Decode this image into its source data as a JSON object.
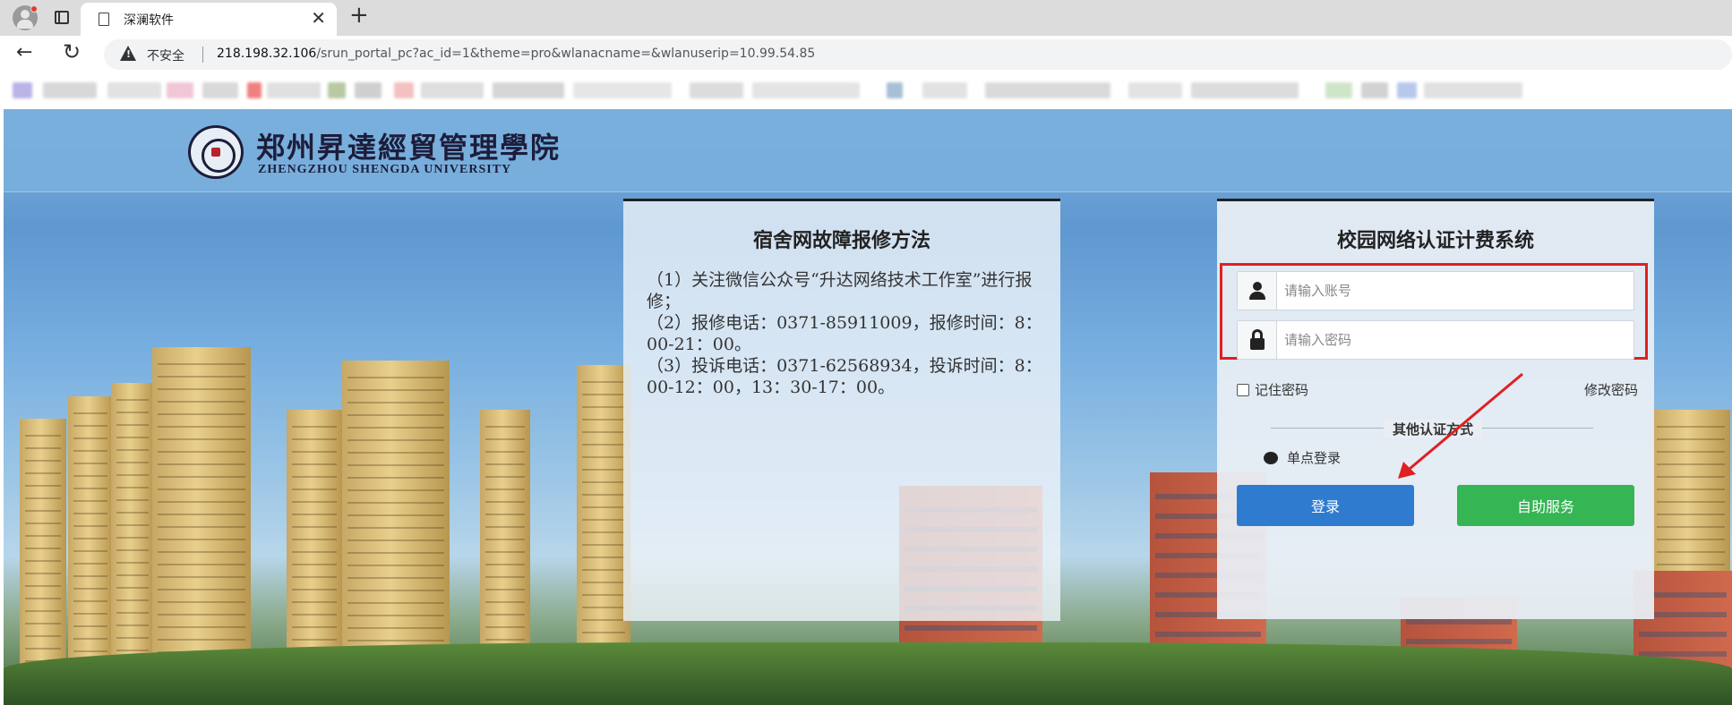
{
  "browser": {
    "tab_title": "深澜软件",
    "new_tab_symbol": "+",
    "close_symbol": "✕",
    "insecure_label": "不安全",
    "url_host": "218.198.32.106",
    "url_path": "/srun_portal_pc?ac_id=1&theme=pro&wlanacname=&wlanuserip=10.99.54.85"
  },
  "header": {
    "logo_cn": "郑州昇達經貿管理學院",
    "logo_en": "ZHENGZHOU SHENGDA UNIVERSITY"
  },
  "notice": {
    "title": "宿舍网故障报修方法",
    "lines": [
      "（1）关注微信公众号“升达网络技术工作室”进行报修；",
      "（2）报修电话：0371-85911009，报修时间：8：00-21：00。",
      "（3）投诉电话：0371-62568934，投诉时间：8：00-12：00，13：30-17：00。"
    ]
  },
  "login": {
    "title": "校园网络认证计费系统",
    "username_placeholder": "请输入账号",
    "password_placeholder": "请输入密码",
    "remember_label": "记住密码",
    "change_password_label": "修改密码",
    "other_auth_label": "其他认证方式",
    "sso_label": "单点登录",
    "login_button": "登录",
    "self_service_button": "自助服务"
  },
  "annotation": {
    "highlight_color": "#e02020"
  }
}
